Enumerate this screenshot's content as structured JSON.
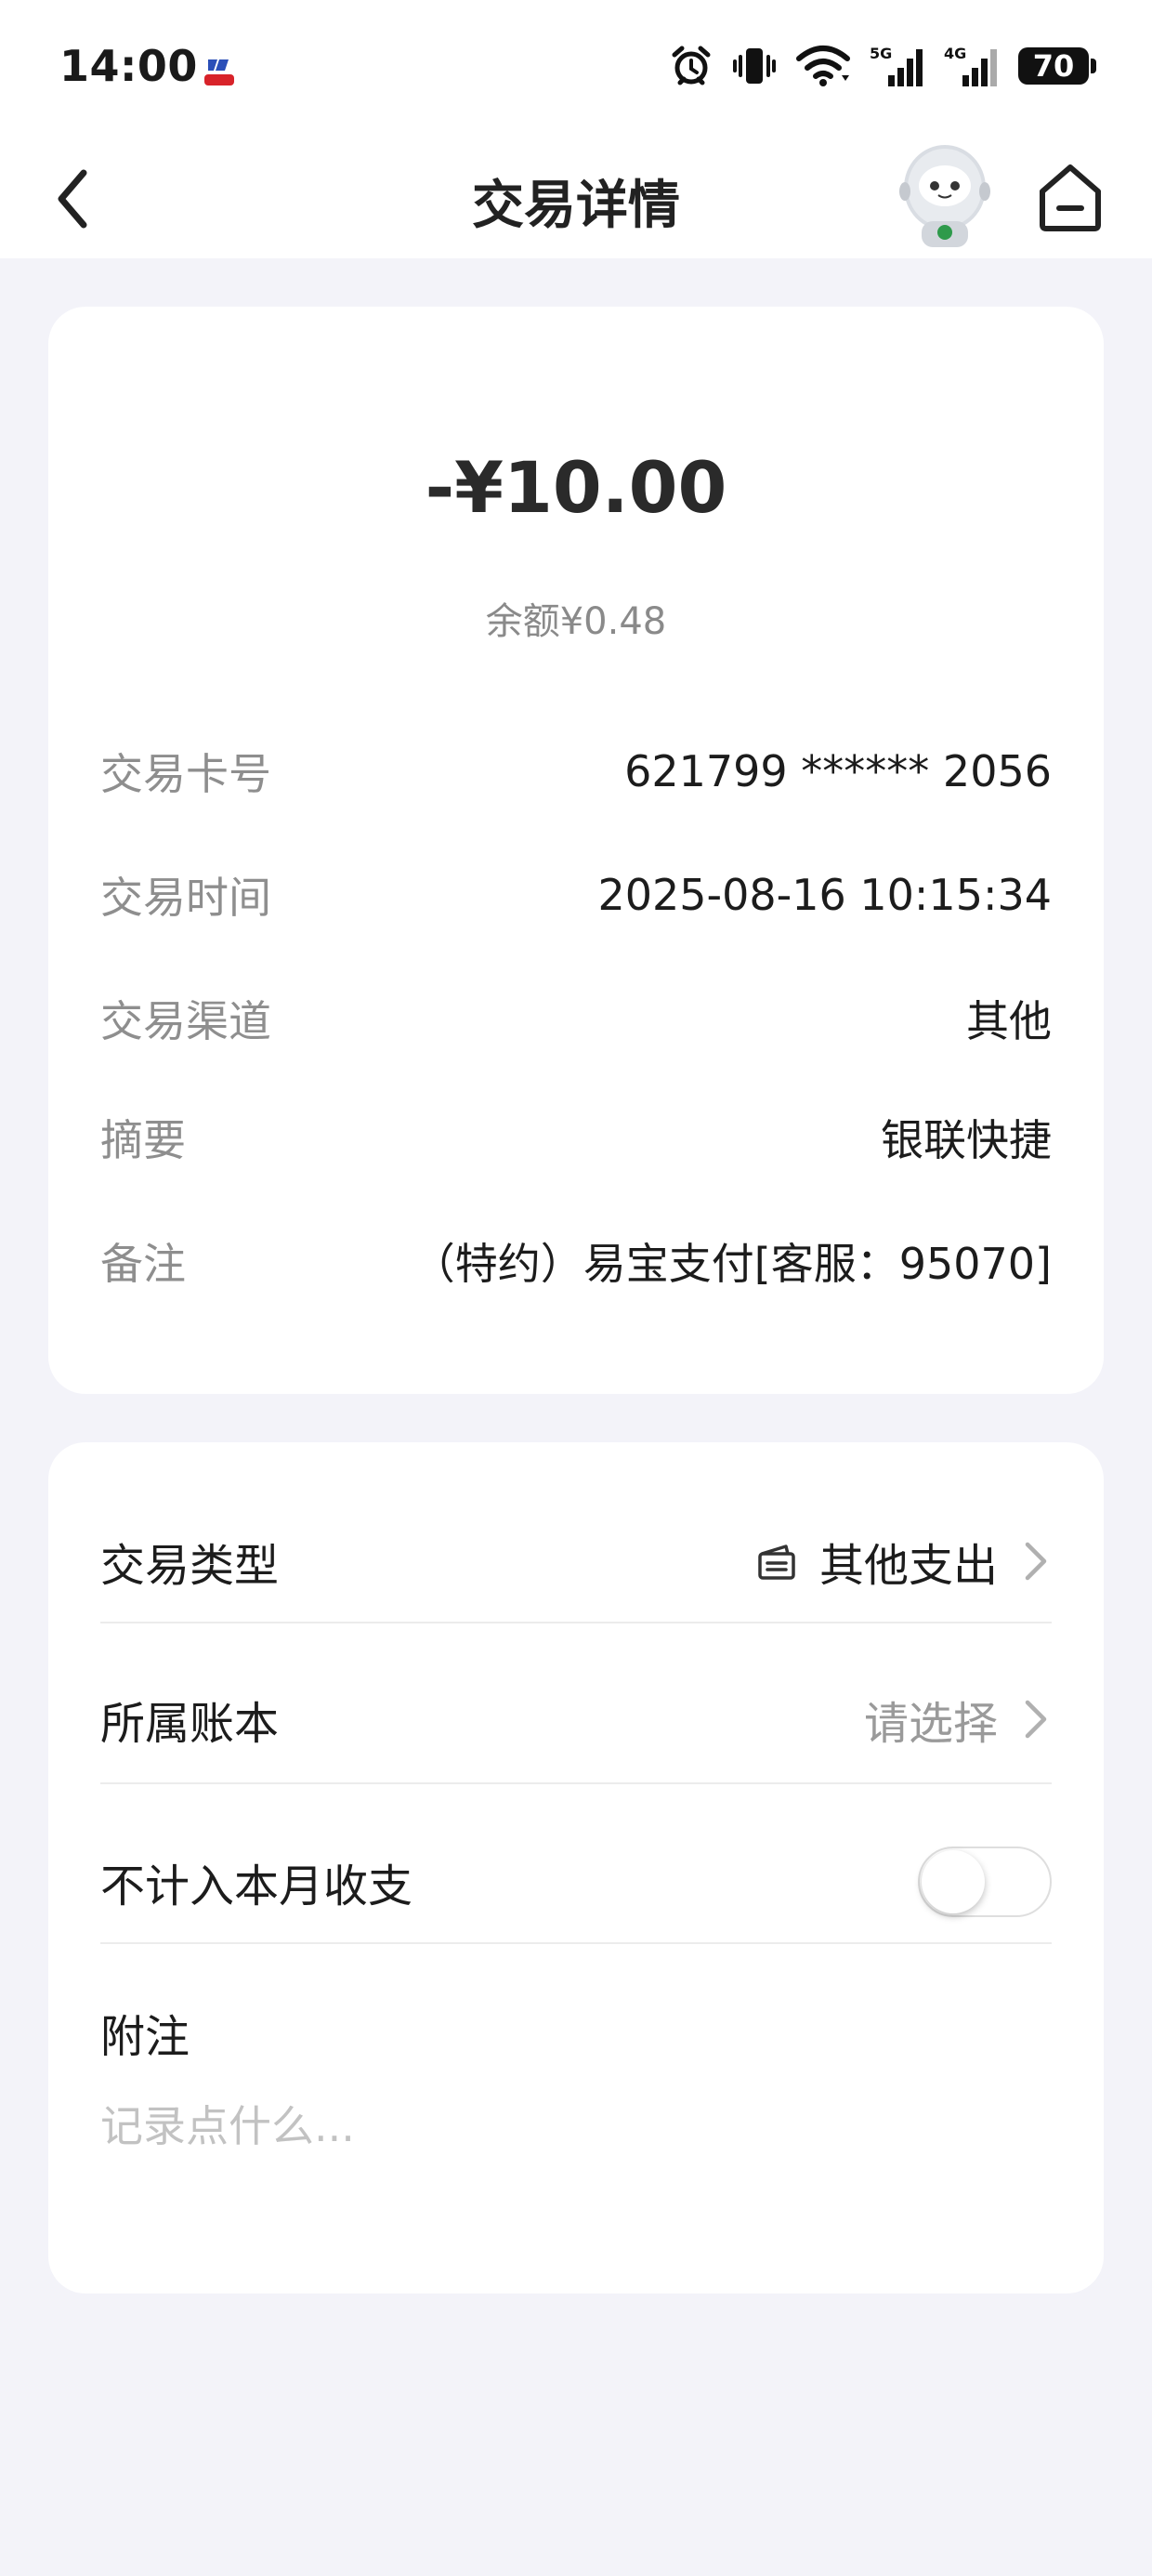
{
  "status_bar": {
    "time": "14:00",
    "battery": "70"
  },
  "nav": {
    "title": "交易详情"
  },
  "summary": {
    "amount": "-¥10.00",
    "balance": "余额¥0.48"
  },
  "details": [
    {
      "label": "交易卡号",
      "value": "621799 ****** 2056"
    },
    {
      "label": "交易时间",
      "value": "2025-08-16 10:15:34"
    },
    {
      "label": "交易渠道",
      "value": "其他"
    },
    {
      "label": "摘要",
      "value": "银联快捷"
    },
    {
      "label": "备注",
      "value": "（特约）易宝支付[客服：95070]"
    }
  ],
  "settings": {
    "type": {
      "label": "交易类型",
      "value": "其他支出",
      "icon": "wallet-icon"
    },
    "ledger": {
      "label": "所属账本",
      "placeholder": "请选择"
    },
    "exclude": {
      "label": "不计入本月收支",
      "enabled": false
    },
    "note": {
      "label": "附注",
      "placeholder": "记录点什么..."
    }
  }
}
